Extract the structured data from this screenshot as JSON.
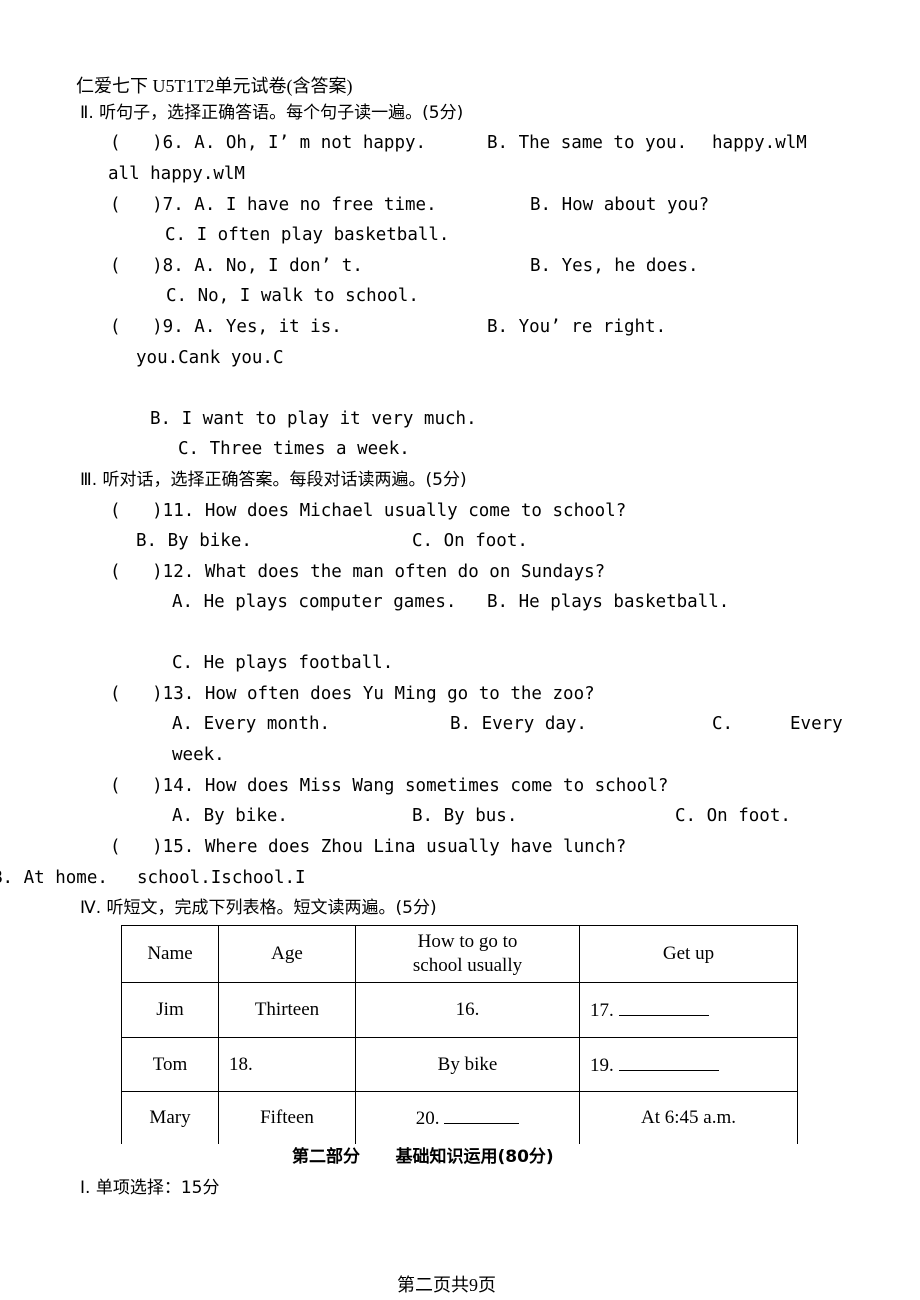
{
  "title": "仁爱七下 U5T1T2单元试卷(含答案)",
  "section2": {
    "heading": "Ⅱ. 听句子，选择正确答语。每个句子读一遍。(5分)",
    "lines": [
      "(   )6. A. Oh, I’ m not happy.",
      "B. The same to you.",
      "happy.wlM",
      "all happy.wlM",
      "(   )7. A. I have no free time.",
      "B. How about you?",
      "C. I often play basketball.",
      "(   )8. A. No, I don’ t.",
      "B. Yes, he does.",
      "C. No, I walk to school.",
      "(   )9. A. Yes, it is.",
      "B. You’ re right.",
      "you.Cank you.C",
      "B. I want to play it very much.",
      "C. Three times a week."
    ]
  },
  "section3": {
    "heading": "Ⅲ. 听对话，选择正确答案。每段对话读两遍。(5分)",
    "lines": [
      "(   )11. How does Michael usually come to school?",
      "B. By bike.",
      "C. On foot.",
      "(   )12. What does the man often do on Sundays?",
      "A. He plays computer games.",
      "B. He plays basketball.",
      "C. He plays football.",
      "(   )13. How often does Yu Ming go to the zoo?",
      "A. Every month.",
      "B. Every day.",
      "C.",
      "Every",
      "week.",
      "(   )14. How does Miss Wang sometimes come to school?",
      "A. By bike.",
      "B. By bus.",
      "C. On foot.",
      "(   )15. Where does Zhou Lina usually have lunch?",
      "B. At home.",
      "school.Ischool.I"
    ]
  },
  "section4": {
    "heading": "Ⅳ. 听短文，完成下列表格。短文读两遍。(5分)",
    "table": {
      "headers": [
        "Name",
        "Age",
        "How to go to school usually",
        "Get up"
      ],
      "rows": [
        [
          "Jim",
          "Thirteen",
          "16.",
          "17."
        ],
        [
          "Tom",
          "18.",
          "By bike",
          "19."
        ],
        [
          "Mary",
          "Fifteen",
          "20.",
          "At 6:45 a.m."
        ]
      ]
    }
  },
  "part2": {
    "heading": "第二部分      基础知识运用(80分)",
    "sub": "Ⅰ. 单项选择：15分"
  },
  "footer": "第二页共9页"
}
